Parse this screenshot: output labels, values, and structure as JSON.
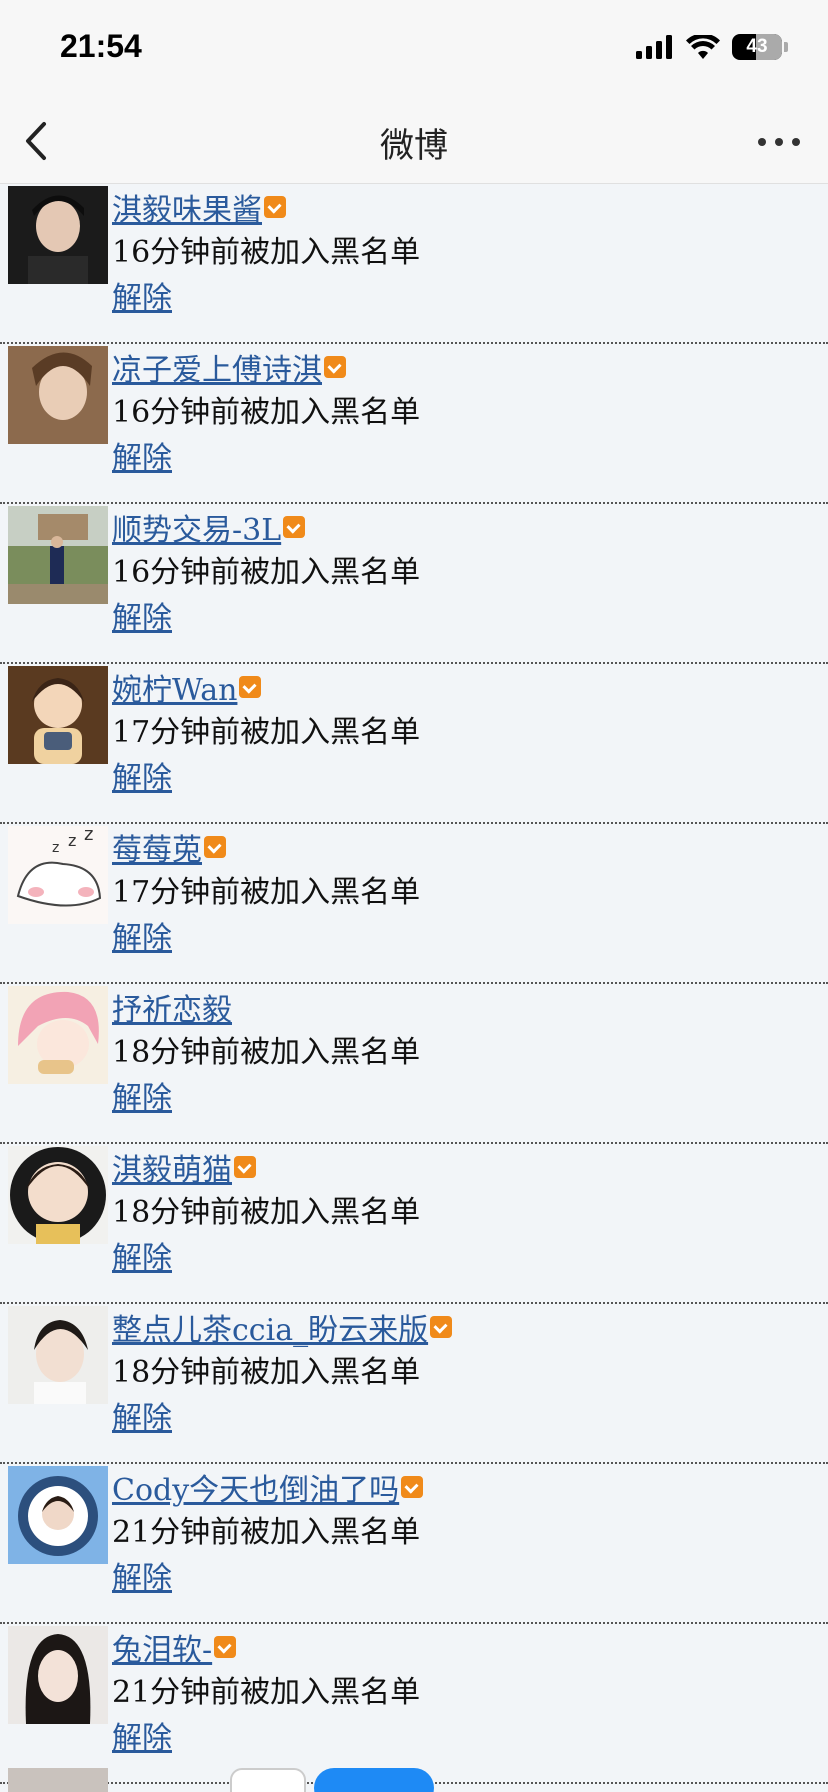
{
  "status_bar": {
    "time": "21:54",
    "battery_level": "43"
  },
  "nav": {
    "title": "微博"
  },
  "blacklist": [
    {
      "name": "淇毅味果酱",
      "verified": true,
      "time": "16分钟前被加入黑名单",
      "action": "解除",
      "avatar": "dark-portrait"
    },
    {
      "name": "凉子爱上傅诗淇",
      "verified": true,
      "time": "16分钟前被加入黑名单",
      "action": "解除",
      "avatar": "warm-portrait"
    },
    {
      "name": "顺势交易-3L",
      "verified": true,
      "time": "16分钟前被加入黑名单",
      "action": "解除",
      "avatar": "outdoor-photo"
    },
    {
      "name": "婉柠Wan",
      "verified": true,
      "time": "17分钟前被加入黑名单",
      "action": "解除",
      "avatar": "cartoon-boy"
    },
    {
      "name": "莓莓莵",
      "verified": true,
      "time": "17分钟前被加入黑名单",
      "action": "解除",
      "avatar": "sleeping-bunny"
    },
    {
      "name": "抒祈恋毅",
      "verified": false,
      "time": "18分钟前被加入黑名单",
      "action": "解除",
      "avatar": "anime-pink-hair"
    },
    {
      "name": "淇毅萌猫",
      "verified": true,
      "time": "18分钟前被加入黑名单",
      "action": "解除",
      "avatar": "round-portrait"
    },
    {
      "name": "整点儿茶ccia_盼云来版",
      "verified": true,
      "time": "18分钟前被加入黑名单",
      "action": "解除",
      "avatar": "light-portrait"
    },
    {
      "name": "Cody今天也倒油了吗",
      "verified": true,
      "time": "21分钟前被加入黑名单",
      "action": "解除",
      "avatar": "blue-frame-portrait"
    },
    {
      "name": "兔泪软-",
      "verified": true,
      "time": "21分钟前被加入黑名单",
      "action": "解除",
      "avatar": "girl-portrait"
    }
  ],
  "colors": {
    "link": "#2a5a9c",
    "badge": "#f08a1a",
    "background": "#f2f5f8"
  }
}
